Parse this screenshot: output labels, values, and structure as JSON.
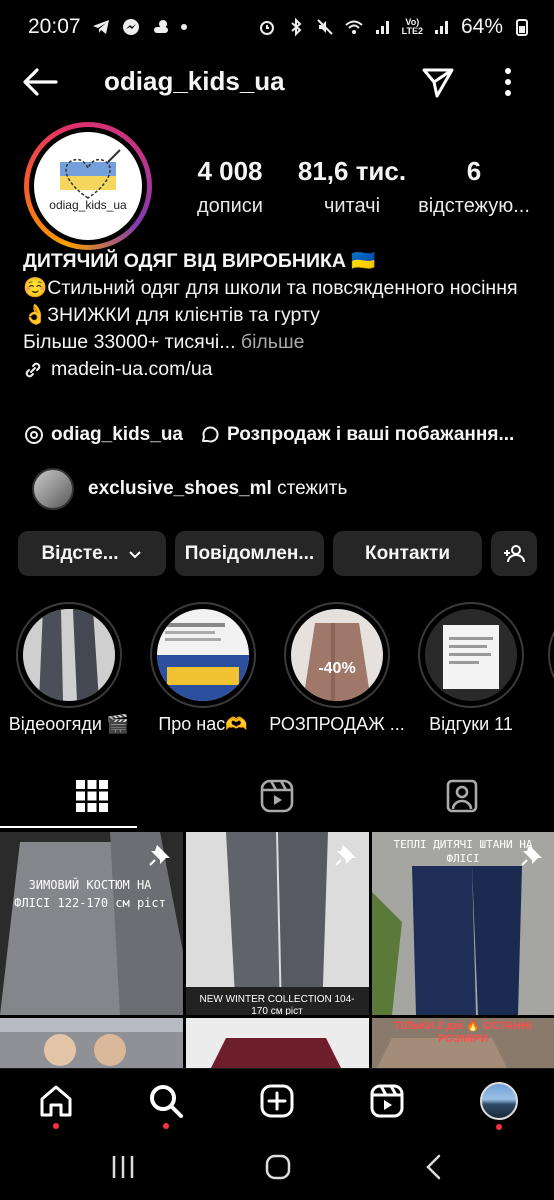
{
  "status_bar": {
    "time": "20:07",
    "battery": "64%",
    "network": "LTE2"
  },
  "header": {
    "username": "odiag_kids_ua"
  },
  "profile": {
    "avatar_text": "odiag_kids_ua",
    "stats": [
      {
        "value": "4 008",
        "label": "дописи"
      },
      {
        "value": "81,6 тис.",
        "label": "читачі"
      },
      {
        "value": "6",
        "label": "відстежую..."
      }
    ],
    "bio": {
      "name": "ДИТЯЧИЙ ОДЯГ ВІД ВИРОБНИКА 🇺🇦",
      "line1": "☺️Стильний одяг для школи та повсякденного носіння",
      "line2": "👌ЗНИЖКИ для клієнтів та гурту",
      "line3": "Більше 33000+ тисячі...",
      "more": "більше",
      "link": "madein-ua.com/ua"
    },
    "threads_handle": "odiag_kids_ua",
    "channel": "Розпродаж і ваші побажання...",
    "followed_by": {
      "user": "exclusive_shoes_ml",
      "action": "стежить"
    }
  },
  "buttons": {
    "following": "Відсте...",
    "message": "Повідомлен...",
    "contacts": "Контакти"
  },
  "highlights": [
    {
      "label": "Відеоогяди 🎬"
    },
    {
      "label": "Про нас🫶"
    },
    {
      "label": "РОЗПРОДАЖ ..."
    },
    {
      "label": "Відгуки 11"
    }
  ],
  "posts": [
    {
      "caption": "ЗИМОВИЙ КОСТЮМ НА ФЛІСІ 122-170 см ріст"
    },
    {
      "caption": "NEW WINTER COLLECTION 104-170 см ріст"
    },
    {
      "caption": "ТЕПЛІ ДИТЯЧІ ШТАНИ НА ФЛІСІ"
    },
    {
      "caption": ""
    },
    {
      "caption": ""
    },
    {
      "caption": "ТІЛЬКИ 2 дні 🔥 ОСТАННІ РОЗМІРИ"
    }
  ],
  "colors": {
    "background": "#000000",
    "button_bg": "#262626",
    "notification": "#ff3040"
  }
}
